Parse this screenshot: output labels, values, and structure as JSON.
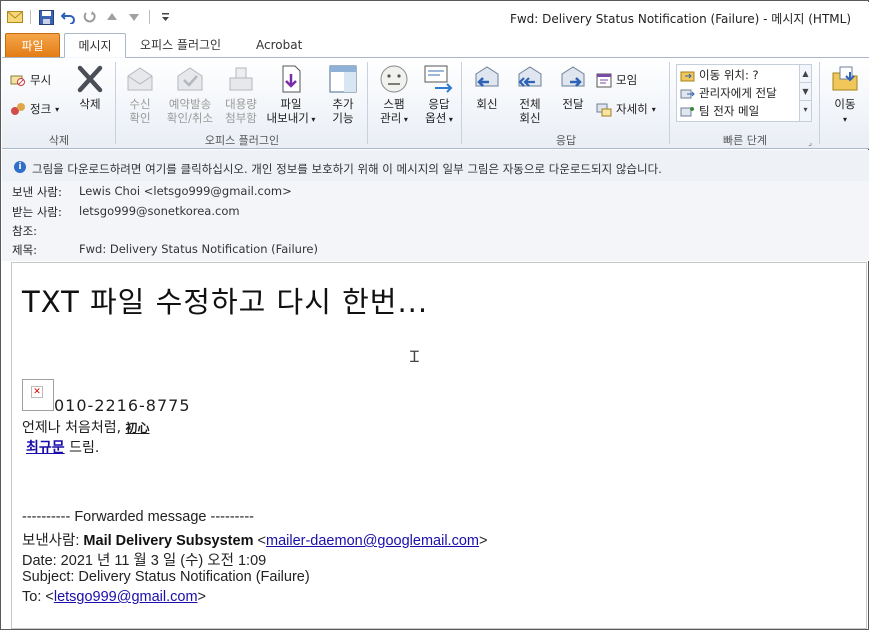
{
  "window": {
    "title": "Fwd: Delivery Status Notification (Failure)  -  메시지 (HTML)"
  },
  "tabs": {
    "file": "파일",
    "message": "메시지",
    "office_plugin": "오피스 플러그인",
    "acrobat": "Acrobat"
  },
  "ribbon": {
    "delete_group": {
      "label": "삭제",
      "ignore": "무시",
      "cleanup": "정크",
      "delete": "삭제"
    },
    "office_group": {
      "label": "오피스 플러그인",
      "read_check_1": "수신",
      "read_check_2": "확인",
      "schedule_1": "예약발송",
      "schedule_2": "확인/취소",
      "bulk_1": "대용량",
      "bulk_2": "첨부함",
      "export_1": "파일",
      "export_2": "내보내기",
      "addon_1": "추가",
      "addon_2": "기능"
    },
    "spam_group": {
      "spam_1": "스팸",
      "spam_2": "관리",
      "reply_opt_1": "응답",
      "reply_opt_2": "옵션"
    },
    "respond_group": {
      "label": "응답",
      "reply": "회신",
      "reply_all_1": "전체",
      "reply_all_2": "회신",
      "forward": "전달",
      "meeting": "모임",
      "more": "자세히"
    },
    "quick_steps": {
      "label": "빠른 단계",
      "items": [
        "이동 위치: ?",
        "관리자에게 전달",
        "팀 전자 메일"
      ]
    },
    "move_group": {
      "move": "이동"
    }
  },
  "infobar": {
    "text": "그림을 다운로드하려면 여기를 클릭하십시오. 개인 정보를 보호하기 위해 이 메시지의 일부 그림은 자동으로 다운로드되지 않습니다."
  },
  "headers": {
    "from_label": "보낸 사람:",
    "from_value": "Lewis Choi <letsgo999@gmail.com>",
    "to_label": "받는 사람:",
    "to_value": "letsgo999@sonetkorea.com",
    "cc_label": "참조:",
    "cc_value": "",
    "subject_label": "제목:",
    "subject_value": "Fwd: Delivery Status Notification (Failure)"
  },
  "message": {
    "headline": "TXT 파일 수정하고 다시 한번...",
    "phone": "010-2216-8775",
    "tagline": "언제나 처음처럼, ",
    "tagline_bold": "初心",
    "sign_name": "최규문",
    "sign_suffix": " 드림.",
    "forward_divider": "---------- Forwarded message ---------",
    "fwd_from_label": "보낸사람: ",
    "fwd_from_name": "Mail Delivery Subsystem",
    "fwd_from_email": "mailer-daemon@googlemail.com",
    "fwd_date": "Date: 2021 년 11 월 3 일 (수) 오전 1:09",
    "fwd_subject": "Subject: Delivery Status Notification (Failure)",
    "fwd_to_label": "To: ",
    "fwd_to_email": "letsgo999@gmail.com"
  }
}
